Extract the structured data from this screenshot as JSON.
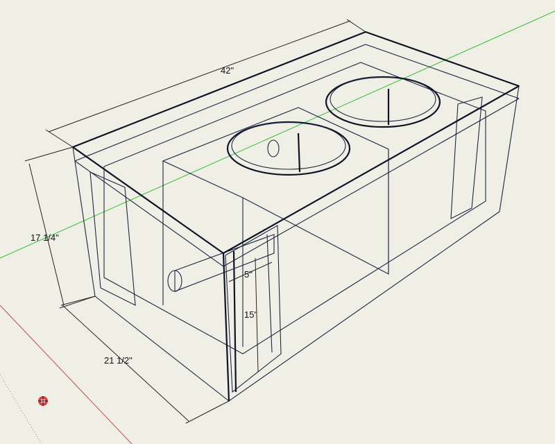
{
  "scene": {
    "background": "#f0efe6",
    "box_color": "#4a6fe0",
    "axis_colors": {
      "green": "#2fbf2f",
      "red": "#c84a4a"
    },
    "origin_icon": "sketchup-origin-axes-icon"
  },
  "dimensions": {
    "length": "42\"",
    "height": "17 1/4\"",
    "depth": "21 1/2\"",
    "port_width": "5\"",
    "port_height": "15\""
  }
}
